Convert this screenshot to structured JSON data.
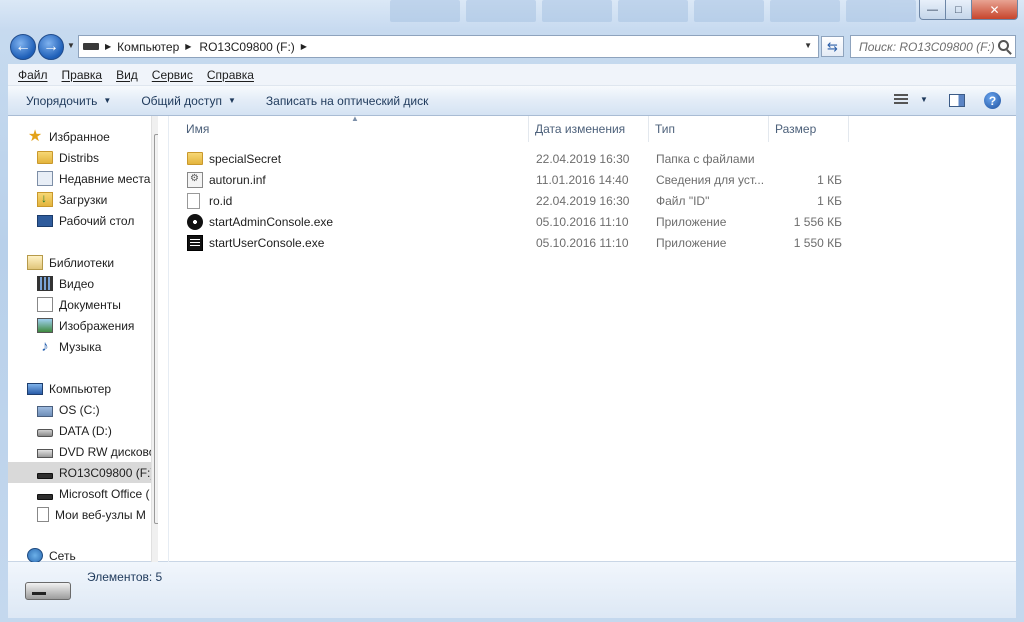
{
  "window": {
    "minimize": "—",
    "maximize": "□",
    "close": "✕"
  },
  "nav": {
    "back_icon": "back-arrow-icon",
    "forward_icon": "forward-arrow-icon",
    "address": [
      "Компьютер",
      "RO13C09800 (F:)"
    ],
    "search_placeholder": "Поиск: RO13C09800 (F:)"
  },
  "menu": [
    "Файл",
    "Правка",
    "Вид",
    "Сервис",
    "Справка"
  ],
  "toolbar": {
    "organize": "Упорядочить",
    "share": "Общий доступ",
    "burn": "Записать на оптический диск"
  },
  "sidebar": {
    "favorites": {
      "label": "Избранное",
      "items": [
        "Distribs",
        "Недавние места",
        "Загрузки",
        "Рабочий стол"
      ]
    },
    "libraries": {
      "label": "Библиотеки",
      "items": [
        "Видео",
        "Документы",
        "Изображения",
        "Музыка"
      ]
    },
    "computer": {
      "label": "Компьютер",
      "items": [
        "OS (C:)",
        "DATA (D:)",
        "DVD RW дисково",
        "RO13C09800 (F:)",
        "Microsoft Office (",
        "Мои веб-узлы M"
      ]
    },
    "network": {
      "label": "Сеть"
    }
  },
  "columns": {
    "name": "Имя",
    "date": "Дата изменения",
    "type": "Тип",
    "size": "Размер"
  },
  "files": [
    {
      "name": "specialSecret",
      "date": "22.04.2019 16:30",
      "type": "Папка с файлами",
      "size": "",
      "icon": "folder-icon"
    },
    {
      "name": "autorun.inf",
      "date": "11.01.2016 14:40",
      "type": "Сведения для уст...",
      "size": "1 КБ",
      "icon": "setup-info-icon"
    },
    {
      "name": "ro.id",
      "date": "22.04.2019 16:30",
      "type": "Файл \"ID\"",
      "size": "1 КБ",
      "icon": "blank-file-icon"
    },
    {
      "name": "startAdminConsole.exe",
      "date": "05.10.2016 11:10",
      "type": "Приложение",
      "size": "1 556 КБ",
      "icon": "disc-app-icon"
    },
    {
      "name": "startUserConsole.exe",
      "date": "05.10.2016 11:10",
      "type": "Приложение",
      "size": "1 550 КБ",
      "icon": "console-app-icon"
    }
  ],
  "status": {
    "count": "Элементов: 5"
  }
}
